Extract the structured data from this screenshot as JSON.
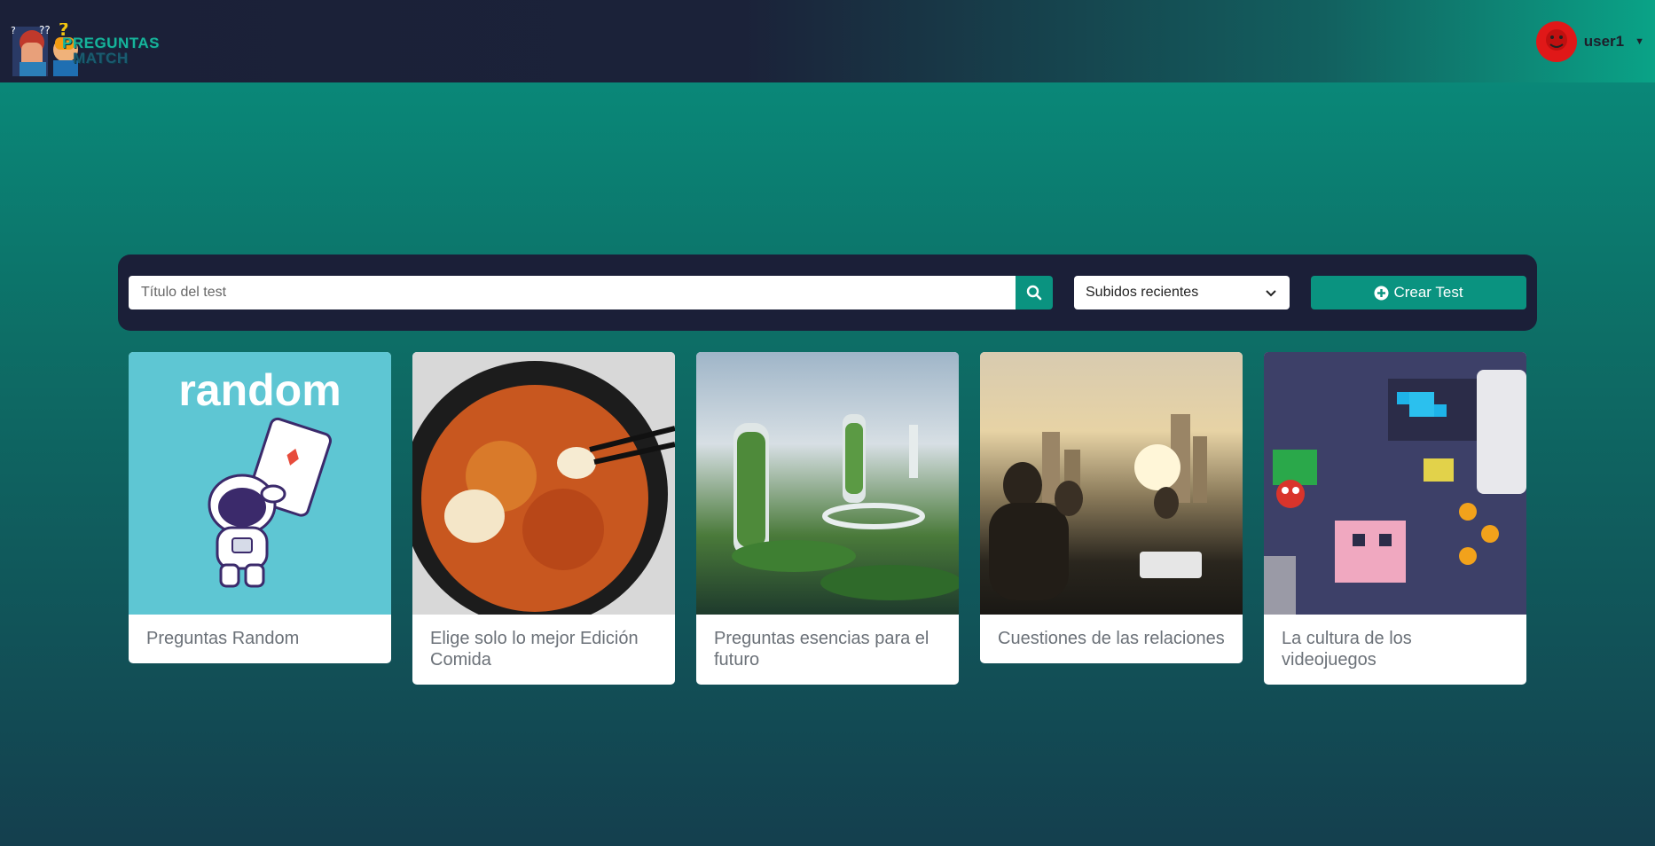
{
  "navbar": {
    "logo_line1": "PREGUNTAS",
    "logo_line2": "MATCH",
    "username": "user1"
  },
  "toolbar": {
    "search_placeholder": "Título del test",
    "sort_selected": "Subidos recientes",
    "create_label": "Crear Test"
  },
  "cards": [
    {
      "title": "Preguntas Random",
      "image_text": "random"
    },
    {
      "title": "Elige solo lo mejor Edición Comida"
    },
    {
      "title": "Preguntas esencias para el futuro"
    },
    {
      "title": "Cuestiones de las relaciones"
    },
    {
      "title": "La cultura de los videojuegos"
    }
  ],
  "colors": {
    "accent": "#0a9380",
    "dark": "#1b1f38"
  }
}
